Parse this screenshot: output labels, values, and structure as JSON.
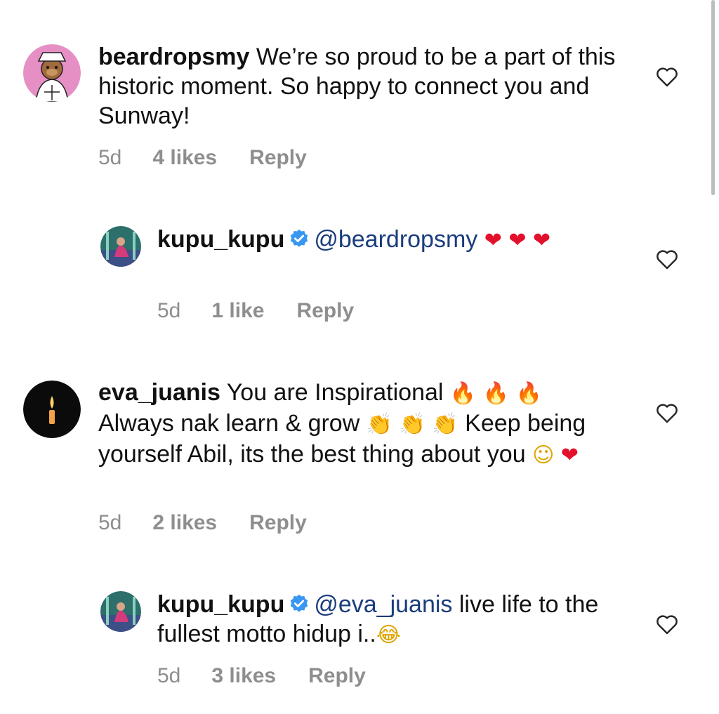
{
  "comments": [
    {
      "username": "beardropsmy",
      "text": " We’re so proud to be a part of this historic moment. So happy to connect you and Sunway!",
      "age": "5d",
      "likes": "4 likes",
      "reply": "Reply"
    },
    {
      "username": "kupu_kupu",
      "mention": "@beardropsmy",
      "emojis": [
        "❤",
        "❤",
        "❤"
      ],
      "age": "5d",
      "likes": "1 like",
      "reply": "Reply"
    },
    {
      "username": "eva_juanis",
      "text1": " You are Inspirational",
      "text2": "Always nak learn & grow",
      "text3": " Keep being yourself Abil, its the best thing about you",
      "emojis": {
        "fire": "🔥",
        "clap": "👏",
        "smile": "☺",
        "heart": "❤"
      },
      "age": "5d",
      "likes": "2 likes",
      "reply": "Reply"
    },
    {
      "username": "kupu_kupu",
      "mention": "@eva_juanis",
      "text": " live life to the fullest motto hidup i..",
      "emoji": "😂",
      "age": "5d",
      "likes": "3 likes",
      "reply": "Reply"
    }
  ],
  "icons": {
    "heart": "heart-outline-icon",
    "verified": "verified-badge-icon"
  },
  "colors": {
    "mention": "#1a3d7c",
    "verified": "#3897f0",
    "meta": "#8e8e8e"
  }
}
